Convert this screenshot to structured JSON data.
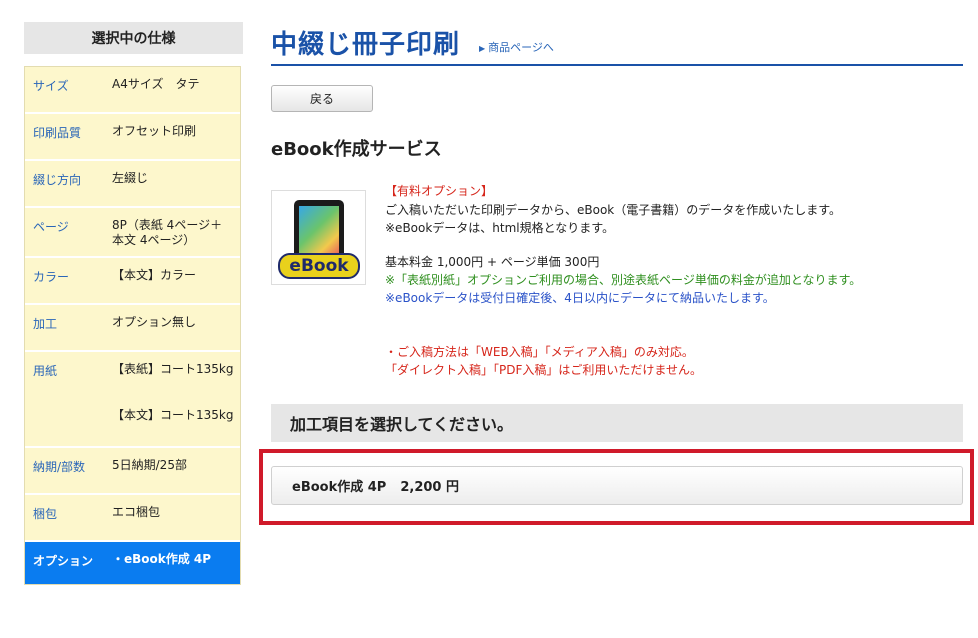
{
  "sidebar": {
    "header": "選択中の仕様",
    "rows": [
      {
        "label": "サイズ",
        "value": "A4サイズ　タテ"
      },
      {
        "label": "印刷品質",
        "value": "オフセット印刷"
      },
      {
        "label": "綴じ方向",
        "value": "左綴じ"
      },
      {
        "label": "ページ",
        "value": "8P（表紙 4ページ＋本文 4ページ）"
      },
      {
        "label": "カラー",
        "value": "【本文】カラー"
      },
      {
        "label": "加工",
        "value": "オプション無し"
      },
      {
        "label": "用紙",
        "value": "【表紙】コート135kg",
        "value2": "【本文】コート135kg"
      },
      {
        "label": "納期/部数",
        "value": "5日納期/25部"
      },
      {
        "label": "梱包",
        "value": "エコ梱包"
      },
      {
        "label": "オプション",
        "value": "・eBook作成 4P"
      }
    ]
  },
  "main": {
    "title": "中綴じ冊子印刷",
    "product_link": "商品ページへ",
    "back_button": "戻る",
    "section_title": "eBook作成サービス",
    "thumb_logo": "eBook",
    "desc": {
      "paid_option": "【有料オプション】",
      "line1": "ご入稿いただいた印刷データから、eBook（電子書籍）のデータを作成いたします。",
      "line2": "※eBookデータは、html規格となります。",
      "base_fee": "基本料金 1,000円 + ページ単価 300円",
      "cover_note": "※「表紙別紙」オプションご利用の場合、別途表紙ページ単価の料金が追加となります。",
      "delivery_note": "※eBookデータは受付日確定後、4日以内にデータにて納品いたします。",
      "submit_note1": "・ご入稿方法は「WEB入稿」「メディア入稿」のみ対応。",
      "submit_note2": "「ダイレクト入稿」「PDF入稿」はご利用いただけません。"
    },
    "options_header": "加工項目を選択してください。",
    "option_item": {
      "label": "eBook作成 4P",
      "price": "2,200 円"
    }
  }
}
